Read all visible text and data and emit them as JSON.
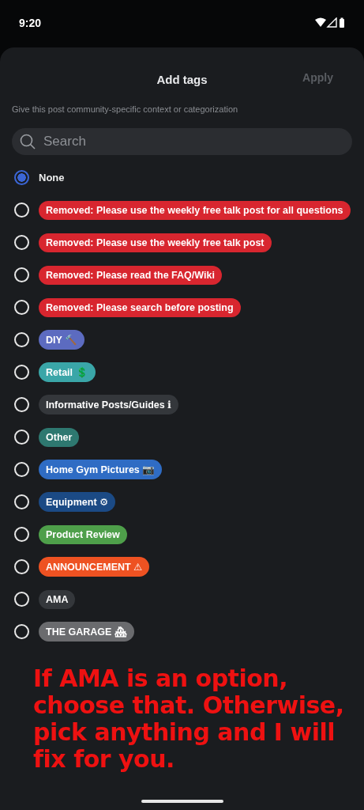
{
  "status_bar": {
    "time": "9:20"
  },
  "sheet": {
    "title": "Add tags",
    "apply": {
      "label": "Apply",
      "disabled": true
    },
    "subtitle": "Give this post community-specific context or categorization"
  },
  "search": {
    "placeholder": "Search"
  },
  "options": [
    {
      "kind": "plain",
      "label": "None",
      "selected": true
    },
    {
      "kind": "tag",
      "label": "Removed: Please use the weekly free talk post for all questions",
      "color": "#d8262f",
      "selected": false
    },
    {
      "kind": "tag",
      "label": "Removed: Please use the weekly free talk post",
      "color": "#d8262f",
      "selected": false
    },
    {
      "kind": "tag",
      "label": "Removed: Please read the FAQ/Wiki",
      "color": "#d8262f",
      "selected": false
    },
    {
      "kind": "tag",
      "label": "Removed: Please search before posting",
      "color": "#d8262f",
      "selected": false
    },
    {
      "kind": "tag",
      "label": "DIY 🔨",
      "color": "#5c6bc0",
      "selected": false
    },
    {
      "kind": "tag",
      "label": "Retail 💲",
      "color": "#3aa6a8",
      "selected": false
    },
    {
      "kind": "tag",
      "label": "Informative Posts/Guides ℹ",
      "color": "#34373b",
      "selected": false
    },
    {
      "kind": "tag",
      "label": "Other",
      "color": "#2e7870",
      "selected": false
    },
    {
      "kind": "tag",
      "label": "Home Gym Pictures 📷",
      "color": "#2f6cc4",
      "selected": false
    },
    {
      "kind": "tag",
      "label": "Equipment ⚙",
      "color": "#1b4a85",
      "selected": false
    },
    {
      "kind": "tag",
      "label": "Product Review",
      "color": "#4e9f4a",
      "selected": false
    },
    {
      "kind": "tag",
      "label": "ANNOUNCEMENT ⚠",
      "color": "#ee5222",
      "selected": false
    },
    {
      "kind": "tag",
      "label": "AMA",
      "color": "#34373b",
      "selected": false
    },
    {
      "kind": "tag",
      "label": "THE GARAGE 🏘",
      "color": "#6a6b6e",
      "selected": false
    }
  ],
  "annotation": "If AMA is an option, choose that. Otherwise, pick anything and I will fix for you."
}
